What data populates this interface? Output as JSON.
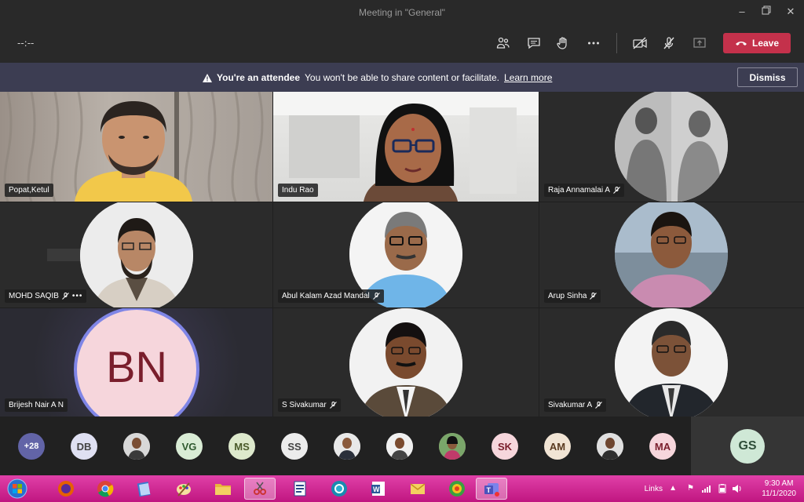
{
  "window": {
    "title": "Meeting in \"General\""
  },
  "toolbar": {
    "timer": "--:--",
    "leave_label": "Leave"
  },
  "banner": {
    "bold": "You're an attendee",
    "text": "You won't be able to share content or facilitate.",
    "link": "Learn more",
    "dismiss": "Dismiss"
  },
  "tiles": [
    {
      "name": "Popat,Ketul"
    },
    {
      "name": "Indu Rao"
    },
    {
      "name": "Raja Annamalai A"
    },
    {
      "name": "MOHD SAQIB"
    },
    {
      "name": "Abul Kalam Azad Mandal"
    },
    {
      "name": "Arup Sinha"
    },
    {
      "name": "Brijesh Nair A N",
      "initials": "BN"
    },
    {
      "name": "S Sivakumar"
    },
    {
      "name": "Sivakumar A"
    }
  ],
  "participants": {
    "overflow": "+28",
    "initials": [
      "DB",
      "VG",
      "MS",
      "SS",
      "SK",
      "AM",
      "MA"
    ],
    "self": "GS"
  },
  "taskbar": {
    "links": "Links",
    "time": "9:30 AM",
    "date": "11/1/2020"
  }
}
